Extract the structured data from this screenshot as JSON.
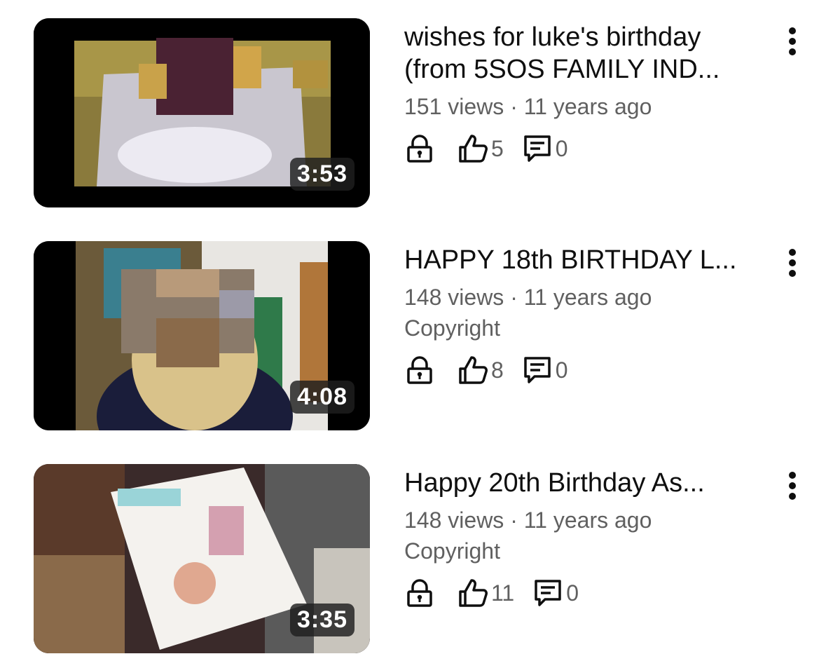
{
  "videos": [
    {
      "title": "wishes for luke's birthday\n(from 5SOS FAMILY IND...",
      "duration": "3:53",
      "views_age": "151 views · 11 years ago",
      "copyright": "",
      "likes": "5",
      "comments": "0"
    },
    {
      "title": "HAPPY 18th BIRTHDAY L...",
      "duration": "4:08",
      "views_age": "148 views · 11 years ago",
      "copyright": "Copyright",
      "likes": "8",
      "comments": "0"
    },
    {
      "title": "Happy 20th Birthday As...",
      "duration": "3:35",
      "views_age": "148 views · 11 years ago",
      "copyright": "Copyright",
      "likes": "11",
      "comments": "0"
    }
  ],
  "icons": {
    "lock": "lock-icon",
    "like": "thumbs-up-icon",
    "comment": "comment-icon",
    "more": "more-vert-icon"
  }
}
